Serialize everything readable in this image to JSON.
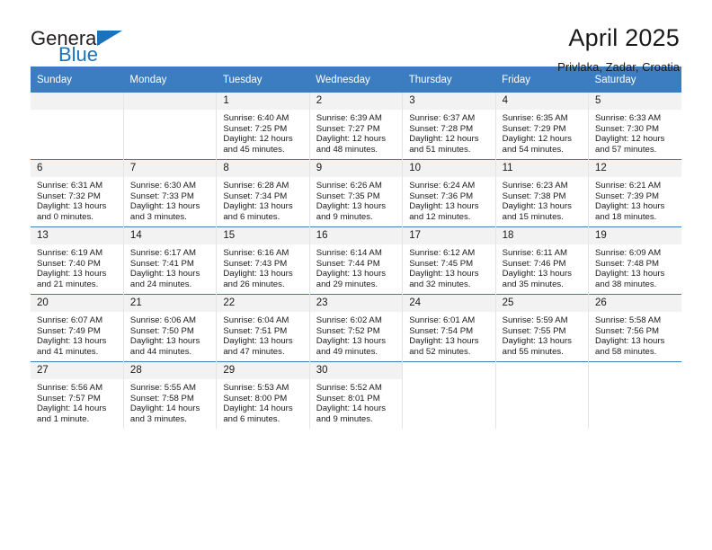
{
  "brand": {
    "name_part1": "General",
    "name_part2": "Blue",
    "triangle_color": "#1b72b8"
  },
  "header": {
    "title": "April 2025",
    "subtitle": "Privlaka, Zadar, Croatia"
  },
  "theme": {
    "header_bg": "#3b7dc0",
    "daynum_bg": "#f2f2f2",
    "grid_line": "#e4e4e4",
    "row_rule": "#3b7dc0"
  },
  "weekdays": [
    "Sunday",
    "Monday",
    "Tuesday",
    "Wednesday",
    "Thursday",
    "Friday",
    "Saturday"
  ],
  "weeks": [
    [
      {
        "day": "",
        "blank": true
      },
      {
        "day": "",
        "blank": true
      },
      {
        "day": "1",
        "sunrise": "Sunrise: 6:40 AM",
        "sunset": "Sunset: 7:25 PM",
        "daylight1": "Daylight: 12 hours",
        "daylight2": "and 45 minutes."
      },
      {
        "day": "2",
        "sunrise": "Sunrise: 6:39 AM",
        "sunset": "Sunset: 7:27 PM",
        "daylight1": "Daylight: 12 hours",
        "daylight2": "and 48 minutes."
      },
      {
        "day": "3",
        "sunrise": "Sunrise: 6:37 AM",
        "sunset": "Sunset: 7:28 PM",
        "daylight1": "Daylight: 12 hours",
        "daylight2": "and 51 minutes."
      },
      {
        "day": "4",
        "sunrise": "Sunrise: 6:35 AM",
        "sunset": "Sunset: 7:29 PM",
        "daylight1": "Daylight: 12 hours",
        "daylight2": "and 54 minutes."
      },
      {
        "day": "5",
        "sunrise": "Sunrise: 6:33 AM",
        "sunset": "Sunset: 7:30 PM",
        "daylight1": "Daylight: 12 hours",
        "daylight2": "and 57 minutes."
      }
    ],
    [
      {
        "day": "6",
        "sunrise": "Sunrise: 6:31 AM",
        "sunset": "Sunset: 7:32 PM",
        "daylight1": "Daylight: 13 hours",
        "daylight2": "and 0 minutes."
      },
      {
        "day": "7",
        "sunrise": "Sunrise: 6:30 AM",
        "sunset": "Sunset: 7:33 PM",
        "daylight1": "Daylight: 13 hours",
        "daylight2": "and 3 minutes."
      },
      {
        "day": "8",
        "sunrise": "Sunrise: 6:28 AM",
        "sunset": "Sunset: 7:34 PM",
        "daylight1": "Daylight: 13 hours",
        "daylight2": "and 6 minutes."
      },
      {
        "day": "9",
        "sunrise": "Sunrise: 6:26 AM",
        "sunset": "Sunset: 7:35 PM",
        "daylight1": "Daylight: 13 hours",
        "daylight2": "and 9 minutes."
      },
      {
        "day": "10",
        "sunrise": "Sunrise: 6:24 AM",
        "sunset": "Sunset: 7:36 PM",
        "daylight1": "Daylight: 13 hours",
        "daylight2": "and 12 minutes."
      },
      {
        "day": "11",
        "sunrise": "Sunrise: 6:23 AM",
        "sunset": "Sunset: 7:38 PM",
        "daylight1": "Daylight: 13 hours",
        "daylight2": "and 15 minutes."
      },
      {
        "day": "12",
        "sunrise": "Sunrise: 6:21 AM",
        "sunset": "Sunset: 7:39 PM",
        "daylight1": "Daylight: 13 hours",
        "daylight2": "and 18 minutes."
      }
    ],
    [
      {
        "day": "13",
        "sunrise": "Sunrise: 6:19 AM",
        "sunset": "Sunset: 7:40 PM",
        "daylight1": "Daylight: 13 hours",
        "daylight2": "and 21 minutes."
      },
      {
        "day": "14",
        "sunrise": "Sunrise: 6:17 AM",
        "sunset": "Sunset: 7:41 PM",
        "daylight1": "Daylight: 13 hours",
        "daylight2": "and 24 minutes."
      },
      {
        "day": "15",
        "sunrise": "Sunrise: 6:16 AM",
        "sunset": "Sunset: 7:43 PM",
        "daylight1": "Daylight: 13 hours",
        "daylight2": "and 26 minutes."
      },
      {
        "day": "16",
        "sunrise": "Sunrise: 6:14 AM",
        "sunset": "Sunset: 7:44 PM",
        "daylight1": "Daylight: 13 hours",
        "daylight2": "and 29 minutes."
      },
      {
        "day": "17",
        "sunrise": "Sunrise: 6:12 AM",
        "sunset": "Sunset: 7:45 PM",
        "daylight1": "Daylight: 13 hours",
        "daylight2": "and 32 minutes."
      },
      {
        "day": "18",
        "sunrise": "Sunrise: 6:11 AM",
        "sunset": "Sunset: 7:46 PM",
        "daylight1": "Daylight: 13 hours",
        "daylight2": "and 35 minutes."
      },
      {
        "day": "19",
        "sunrise": "Sunrise: 6:09 AM",
        "sunset": "Sunset: 7:48 PM",
        "daylight1": "Daylight: 13 hours",
        "daylight2": "and 38 minutes."
      }
    ],
    [
      {
        "day": "20",
        "sunrise": "Sunrise: 6:07 AM",
        "sunset": "Sunset: 7:49 PM",
        "daylight1": "Daylight: 13 hours",
        "daylight2": "and 41 minutes."
      },
      {
        "day": "21",
        "sunrise": "Sunrise: 6:06 AM",
        "sunset": "Sunset: 7:50 PM",
        "daylight1": "Daylight: 13 hours",
        "daylight2": "and 44 minutes."
      },
      {
        "day": "22",
        "sunrise": "Sunrise: 6:04 AM",
        "sunset": "Sunset: 7:51 PM",
        "daylight1": "Daylight: 13 hours",
        "daylight2": "and 47 minutes."
      },
      {
        "day": "23",
        "sunrise": "Sunrise: 6:02 AM",
        "sunset": "Sunset: 7:52 PM",
        "daylight1": "Daylight: 13 hours",
        "daylight2": "and 49 minutes."
      },
      {
        "day": "24",
        "sunrise": "Sunrise: 6:01 AM",
        "sunset": "Sunset: 7:54 PM",
        "daylight1": "Daylight: 13 hours",
        "daylight2": "and 52 minutes."
      },
      {
        "day": "25",
        "sunrise": "Sunrise: 5:59 AM",
        "sunset": "Sunset: 7:55 PM",
        "daylight1": "Daylight: 13 hours",
        "daylight2": "and 55 minutes."
      },
      {
        "day": "26",
        "sunrise": "Sunrise: 5:58 AM",
        "sunset": "Sunset: 7:56 PM",
        "daylight1": "Daylight: 13 hours",
        "daylight2": "and 58 minutes."
      }
    ],
    [
      {
        "day": "27",
        "sunrise": "Sunrise: 5:56 AM",
        "sunset": "Sunset: 7:57 PM",
        "daylight1": "Daylight: 14 hours",
        "daylight2": "and 1 minute."
      },
      {
        "day": "28",
        "sunrise": "Sunrise: 5:55 AM",
        "sunset": "Sunset: 7:58 PM",
        "daylight1": "Daylight: 14 hours",
        "daylight2": "and 3 minutes."
      },
      {
        "day": "29",
        "sunrise": "Sunrise: 5:53 AM",
        "sunset": "Sunset: 8:00 PM",
        "daylight1": "Daylight: 14 hours",
        "daylight2": "and 6 minutes."
      },
      {
        "day": "30",
        "sunrise": "Sunrise: 5:52 AM",
        "sunset": "Sunset: 8:01 PM",
        "daylight1": "Daylight: 14 hours",
        "daylight2": "and 9 minutes."
      },
      {
        "day": "",
        "void": true
      },
      {
        "day": "",
        "void": true
      },
      {
        "day": "",
        "void": true
      }
    ]
  ]
}
